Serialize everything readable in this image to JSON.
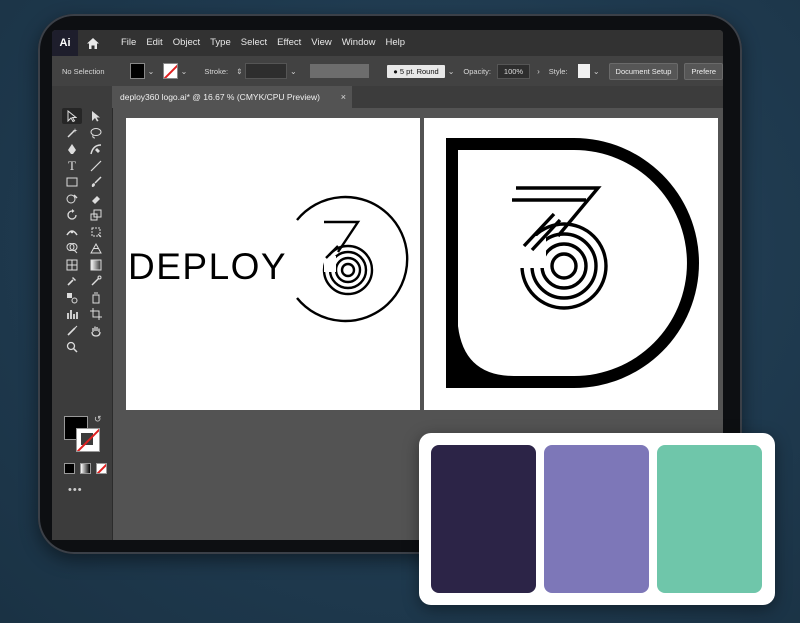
{
  "menubar": {
    "app_logo": "Ai",
    "items": [
      "File",
      "Edit",
      "Object",
      "Type",
      "Select",
      "Effect",
      "View",
      "Window",
      "Help"
    ]
  },
  "control_bar": {
    "selection": "No Selection",
    "stroke_label": "Stroke:",
    "brush": "5 pt. Round",
    "opacity_label": "Opacity:",
    "opacity_value": "100%",
    "style_label": "Style:",
    "document_setup": "Document Setup",
    "preferences": "Prefere"
  },
  "document_tab": {
    "title": "deploy360 logo.ai* @ 16.67 % (CMYK/CPU Preview)",
    "close": "×"
  },
  "artboard1": {
    "wordmark": "DEPLOY"
  },
  "toolbar": {
    "more": "•••"
  },
  "palette": {
    "colors": [
      "#2c2447",
      "#7d77b8",
      "#6fc6aa"
    ]
  },
  "colors": {
    "accent_red": "#e02020",
    "ui_dark": "#323232",
    "canvas": "#535353"
  }
}
